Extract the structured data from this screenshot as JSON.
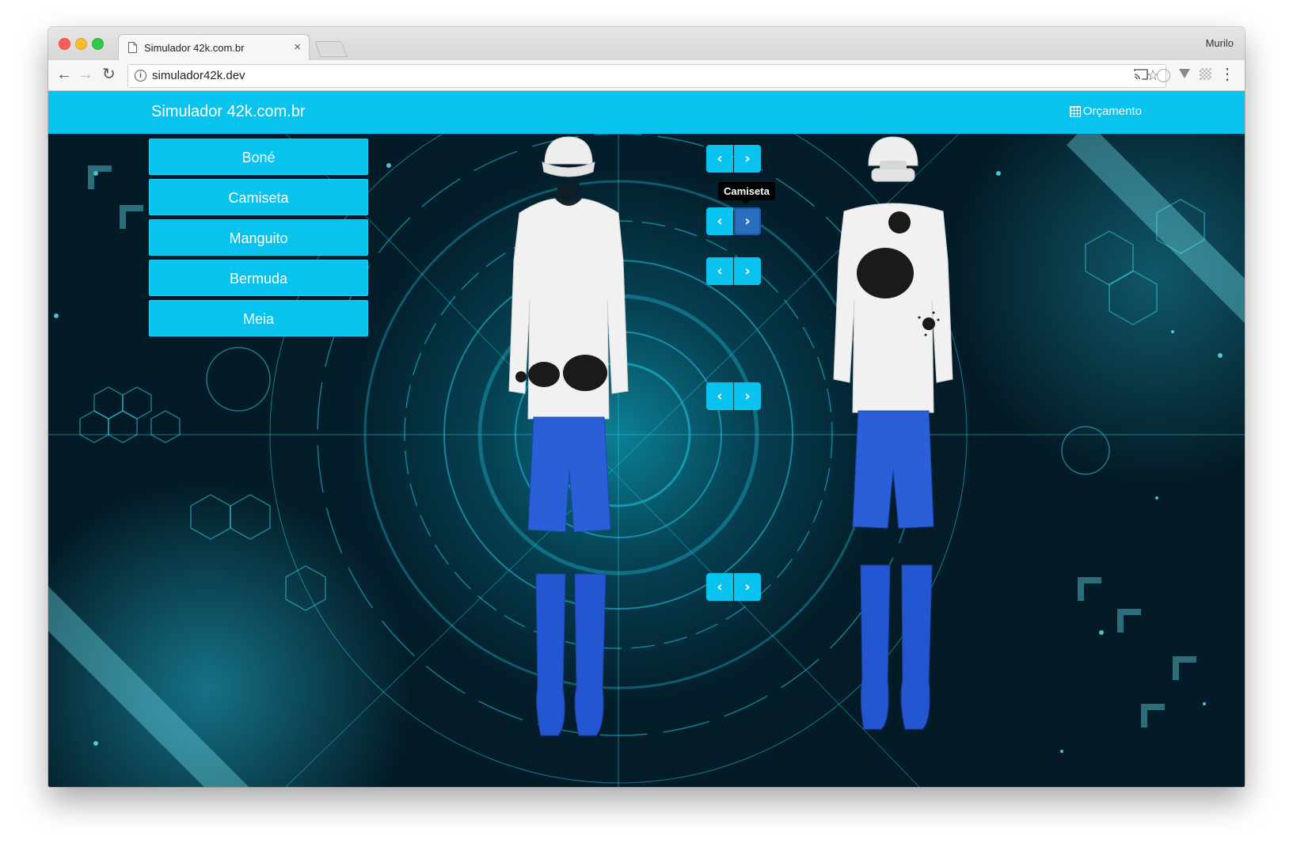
{
  "browser": {
    "tab_title": "Simulador 42k.com.br",
    "tab_close": "×",
    "profile_name": "Murilo",
    "url": "simulador42k.dev",
    "back": "←",
    "forward": "→",
    "reload": "↻",
    "star": "☆",
    "menu": "⋮"
  },
  "navbar": {
    "brand": "Simulador 42k.com.br",
    "budget_label": "Orçamento",
    "color": "#09c3ef"
  },
  "menu": {
    "items": [
      {
        "label": "Boné"
      },
      {
        "label": "Camiseta"
      },
      {
        "label": "Manguito"
      },
      {
        "label": "Bermuda"
      },
      {
        "label": "Meia"
      }
    ]
  },
  "selectors": {
    "prev": "‹",
    "next": "›",
    "tooltip": "Camiseta"
  },
  "colors": {
    "accent": "#09c3ef",
    "active_arrow": "#2a6fbf",
    "shorts": "#2a5fd8",
    "socks": "#2456d2",
    "shirt": "#f1f1f1",
    "cap": "#eeeeee",
    "dots": "#1a1a1a"
  }
}
